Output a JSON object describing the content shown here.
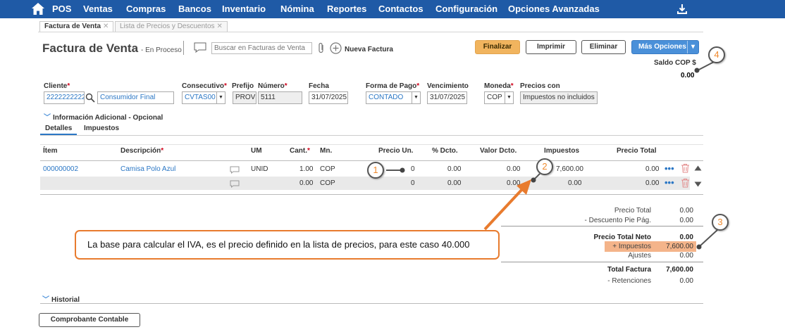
{
  "nav": {
    "items": [
      "POS",
      "Ventas",
      "Compras",
      "Bancos",
      "Inventario",
      "Nómina",
      "Reportes",
      "Contactos",
      "Configuración",
      "Opciones Avanzadas"
    ]
  },
  "tabs": [
    {
      "label": "Factura de Venta"
    },
    {
      "label": "Lista de Precios y Descuentos"
    }
  ],
  "header": {
    "title": "Factura de Venta",
    "status": "- En Proceso",
    "search_placeholder": "Buscar en Facturas de Venta",
    "new_invoice": "Nueva Factura",
    "btn_finalizar": "Finalizar",
    "btn_imprimir": "Imprimir",
    "btn_eliminar": "Eliminar",
    "btn_mas": "Más Opciones",
    "saldo_label": "Saldo COP $",
    "saldo_value": "0.00"
  },
  "form": {
    "cliente_label": "Cliente",
    "cliente_id": "222222222222",
    "cliente_name": "Consumidor Final",
    "consecutivo_label": "Consecutivo",
    "consecutivo": "CVTAS00",
    "prefijo_label": "Prefijo",
    "prefijo": "PROV",
    "numero_label": "Número",
    "numero": "5111",
    "fecha_label": "Fecha",
    "fecha": "31/07/2025",
    "forma_pago_label": "Forma de Pago",
    "forma_pago": "CONTADO",
    "vencimiento_label": "Vencimiento",
    "vencimiento": "31/07/2025",
    "moneda_label": "Moneda",
    "moneda": "COP",
    "precios_con_label": "Precios con",
    "precios_con": "Impuestos no incluidos",
    "required_mark": "*"
  },
  "info_adicional": "Información Adicional - Opcional",
  "subtabs": [
    "Detalles",
    "Impuestos"
  ],
  "table": {
    "columns": [
      "Ítem",
      "Descripción",
      "UM",
      "Cant.",
      "Mn.",
      "Precio Un.",
      "% Dcto.",
      "Valor Dcto.",
      "Impuestos",
      "Precio Total"
    ],
    "rows": [
      {
        "item": "000000002",
        "descripcion": "Camisa Polo Azul",
        "um": "UNID",
        "cant": "1.00",
        "mn": "COP",
        "precio_un": "0",
        "pct_dcto": "0.00",
        "valor_dcto": "0.00",
        "impuestos": "7,600.00",
        "precio_total": "0.00"
      },
      {
        "item": "",
        "descripcion": "",
        "um": "",
        "cant": "0.00",
        "mn": "COP",
        "precio_un": "0",
        "pct_dcto": "0.00",
        "valor_dcto": "0.00",
        "impuestos": "0.00",
        "precio_total": "0.00"
      }
    ]
  },
  "totals": {
    "precio_total_label": "Precio Total",
    "precio_total": "0.00",
    "descuento_label": "- Descuento Pie Pág.",
    "descuento": "0.00",
    "neto_label": "Precio Total Neto",
    "neto": "0.00",
    "impuestos_label": "+ Impuestos",
    "impuestos": "7,600.00",
    "ajustes_label": "Ajustes",
    "ajustes": "0.00",
    "total_factura_label": "Total Factura",
    "total_factura": "7,600.00",
    "retenciones_label": "- Retenciones",
    "retenciones": "0.00"
  },
  "callout": "La base para calcular el IVA, es el precio definido en la lista de precios, para este caso 40.000",
  "badges": [
    "1",
    "2",
    "3",
    "4"
  ],
  "historial": "Historial",
  "btn_comprobante": "Comprobante Contable",
  "colors": {
    "nav_bg": "#1f5aa6",
    "accent_orange": "#e87b2e",
    "finalizar_bg": "#f1b45e",
    "mas_opciones_bg": "#4a90d9",
    "link_blue": "#2b77c5",
    "impuestos_highlight": "#f4b48a"
  }
}
